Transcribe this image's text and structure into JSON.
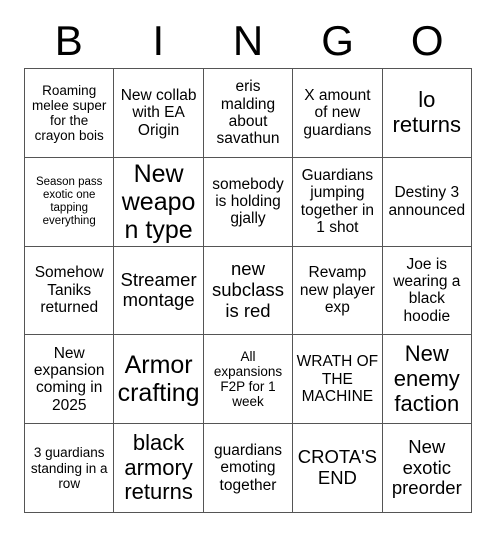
{
  "card": {
    "title": "BINGO",
    "header_letters": [
      "B",
      "I",
      "N",
      "G",
      "O"
    ],
    "rows": [
      [
        {
          "text": "Roaming melee super for the crayon bois",
          "size": "fs-sm"
        },
        {
          "text": "New collab with EA Origin",
          "size": "fs-md"
        },
        {
          "text": "eris malding about savathun",
          "size": "fs-md"
        },
        {
          "text": "X amount of new guardians",
          "size": "fs-md"
        },
        {
          "text": "lo returns",
          "size": "fs-xl"
        }
      ],
      [
        {
          "text": "Season pass exotic one tapping everything",
          "size": "fs-xs"
        },
        {
          "text": "New weapon type",
          "size": "fs-xxl"
        },
        {
          "text": "somebody is holding gjally",
          "size": "fs-md"
        },
        {
          "text": "Guardians jumping together in 1 shot",
          "size": "fs-md"
        },
        {
          "text": "Destiny 3 announced",
          "size": "fs-md"
        }
      ],
      [
        {
          "text": "Somehow Taniks returned",
          "size": "fs-md"
        },
        {
          "text": "Streamer montage",
          "size": "fs-lg"
        },
        {
          "text": "new subclass is red",
          "size": "fs-lg"
        },
        {
          "text": "Revamp new player exp",
          "size": "fs-md"
        },
        {
          "text": "Joe is wearing a black hoodie",
          "size": "fs-md"
        }
      ],
      [
        {
          "text": "New expansion coming in 2025",
          "size": "fs-md"
        },
        {
          "text": "Armor crafting",
          "size": "fs-xxl"
        },
        {
          "text": "All expansions F2P for 1 week",
          "size": "fs-sm"
        },
        {
          "text": "WRATH OF THE MACHINE",
          "size": "fs-md"
        },
        {
          "text": "New enemy faction",
          "size": "fs-xl"
        }
      ],
      [
        {
          "text": "3 guardians standing in a row",
          "size": "fs-sm"
        },
        {
          "text": "black armory returns",
          "size": "fs-xl"
        },
        {
          "text": "guardians emoting together",
          "size": "fs-md"
        },
        {
          "text": "CROTA'S END",
          "size": "fs-lg"
        },
        {
          "text": "New exotic preorder",
          "size": "fs-lg"
        }
      ]
    ]
  },
  "colors": {
    "background": "#ffffff",
    "text": "#000000",
    "grid_line": "#555555"
  }
}
